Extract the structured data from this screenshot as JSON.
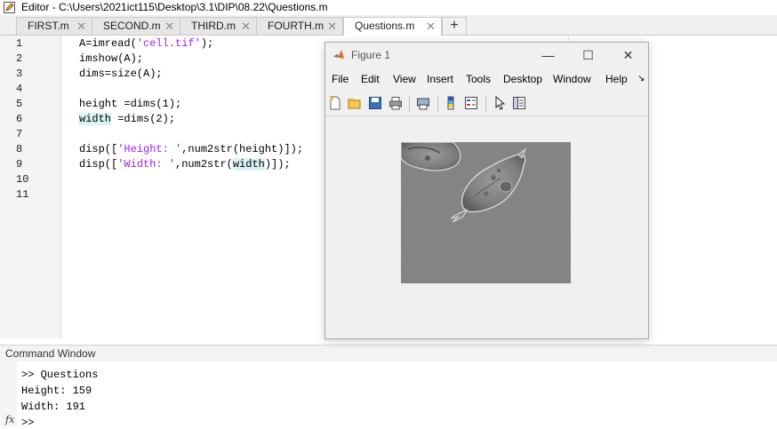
{
  "window": {
    "title": "Editor - C:\\Users\\2021ict115\\Desktop\\3.1\\DIP\\08.22\\Questions.m"
  },
  "tabs": [
    {
      "label": "FIRST.m"
    },
    {
      "label": "SECOND.m"
    },
    {
      "label": "THIRD.m"
    },
    {
      "label": "FOURTH.m"
    },
    {
      "label": "Questions.m",
      "active": true
    }
  ],
  "tab_close": "✕",
  "tab_add": "+",
  "editor": {
    "line_numbers": [
      "1",
      "2",
      "3",
      "4",
      "5",
      "6",
      "7",
      "8",
      "9",
      "10",
      "11"
    ],
    "lines": {
      "l1_pre": "A=imread(",
      "l1_str": "'cell.tif'",
      "l1_post": ");",
      "l2": "imshow(A);",
      "l3": "dims=size(A);",
      "l5": "height =dims(1);",
      "l6_var": "width",
      "l6_post": " =dims(2);",
      "l8_pre": "disp([",
      "l8_str": "'Height: '",
      "l8_post": ",num2str(height)]);",
      "l9_pre": "disp([",
      "l9_str": "'Width: '",
      "l9_mid": ",num2str(",
      "l9_var": "width",
      "l9_post": ")]);"
    }
  },
  "command_window": {
    "title": "Command Window",
    "lines": [
      ">> Questions",
      "Height: 159",
      "Width: 191",
      ">>"
    ],
    "fx_label": "fx"
  },
  "figure": {
    "title": "Figure 1",
    "controls": {
      "minimize": "—",
      "maximize": "☐",
      "close": "✕"
    },
    "menu": [
      "File",
      "Edit",
      "View",
      "Insert",
      "Tools",
      "Desktop",
      "Window",
      "Help"
    ],
    "menu_overflow": "↘",
    "toolbar_icons": [
      "new-figure-icon",
      "open-file-icon",
      "save-icon",
      "print-icon",
      "print-preview-icon",
      "colorbar-icon",
      "legend-icon",
      "pointer-icon",
      "property-editor-icon"
    ],
    "image_alt": "cell.tif"
  },
  "colors": {
    "string": "#a020f0",
    "highlight": "#d8f3f3",
    "matlab_orange": "#e26a1f"
  }
}
